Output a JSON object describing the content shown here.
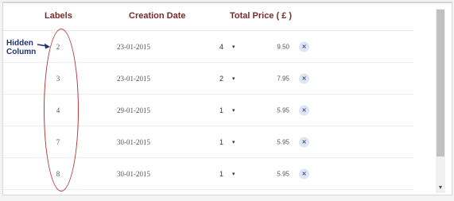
{
  "table": {
    "headers": {
      "labels": "Labels",
      "creation_date": "Creation Date",
      "total_price": "Total Price ( £ )"
    },
    "rows": [
      {
        "label": "2",
        "date": "23-01-2015",
        "qty": "4",
        "price": "9.50"
      },
      {
        "label": "3",
        "date": "23-01-2015",
        "qty": "2",
        "price": "7.95"
      },
      {
        "label": "4",
        "date": "29-01-2015",
        "qty": "1",
        "price": "5.95"
      },
      {
        "label": "7",
        "date": "30-01-2015",
        "qty": "1",
        "price": "5.95"
      },
      {
        "label": "8",
        "date": "30-01-2015",
        "qty": "1",
        "price": "5.95"
      }
    ],
    "caret_glyph": "▾",
    "remove_glyph": "×"
  },
  "annotation": {
    "line1": "Hidden",
    "line2": "Column",
    "color": "#b33a3a"
  },
  "icons": {
    "remove": "close-icon",
    "qty_dropdown": "caret-down-icon",
    "scroll_down": "scroll-down-arrow-icon"
  },
  "colors": {
    "header_text": "#7a2a2a",
    "remove_badge_bg": "#dfe6f2",
    "remove_badge_fg": "#3b5ea8",
    "annotation_text": "#22336b"
  }
}
